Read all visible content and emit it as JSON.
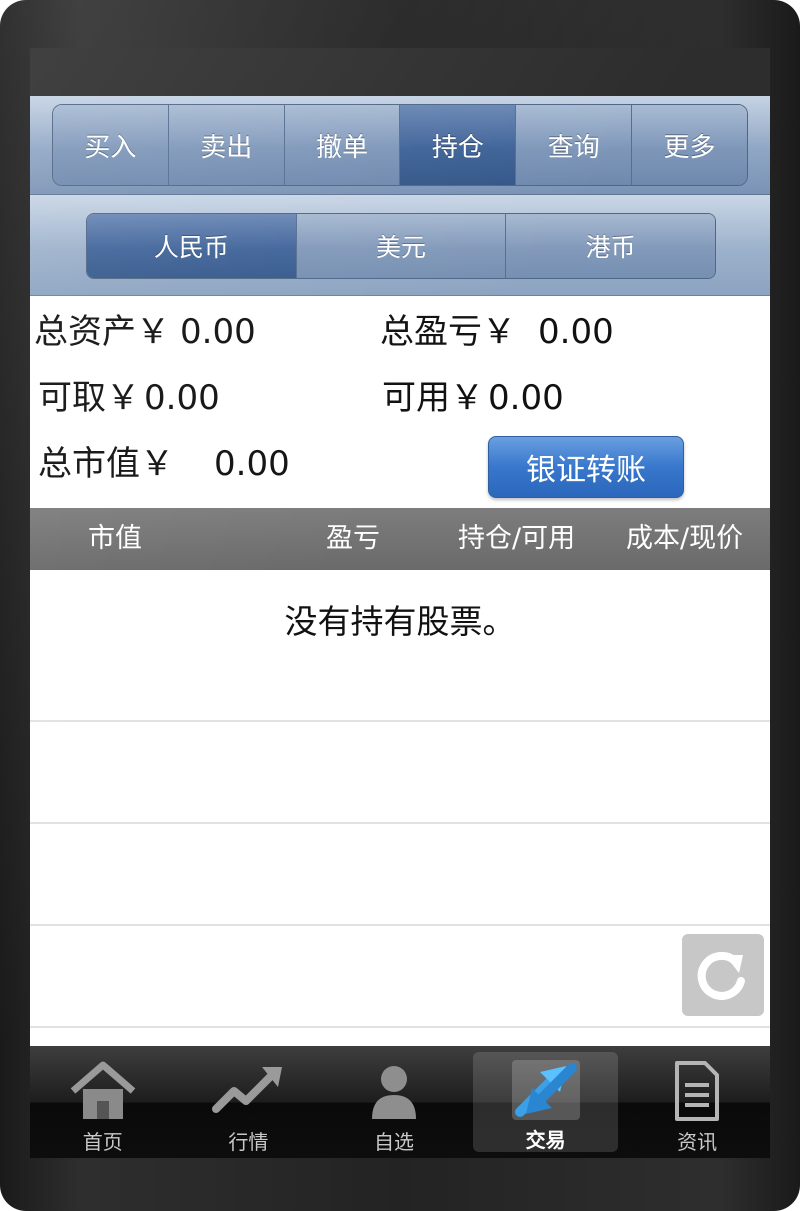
{
  "top_tabs": [
    {
      "label": "买入"
    },
    {
      "label": "卖出"
    },
    {
      "label": "撤单"
    },
    {
      "label": "持仓"
    },
    {
      "label": "查询"
    },
    {
      "label": "更多"
    }
  ],
  "currency_tabs": [
    {
      "label": "人民币"
    },
    {
      "label": "美元"
    },
    {
      "label": "港币"
    }
  ],
  "summary": {
    "total_assets": {
      "label": "总资产￥",
      "value": "0.00"
    },
    "total_pnl": {
      "label": "总盈亏￥",
      "value": "0.00"
    },
    "withdrawable": {
      "label": "可取￥",
      "value": "0.00"
    },
    "available": {
      "label": "可用￥",
      "value": "0.00"
    },
    "market_value": {
      "label": "总市值￥",
      "value": "0.00"
    },
    "transfer_button": "银证转账"
  },
  "table": {
    "columns": [
      "市值",
      "盈亏",
      "持仓/可用",
      "成本/现价"
    ],
    "empty_message": "没有持有股票。"
  },
  "bottom_nav": [
    {
      "label": "首页",
      "icon": "home-icon"
    },
    {
      "label": "行情",
      "icon": "trend-chart-icon"
    },
    {
      "label": "自选",
      "icon": "person-icon"
    },
    {
      "label": "交易",
      "icon": "trade-exchange-icon"
    },
    {
      "label": "资讯",
      "icon": "document-icon"
    }
  ],
  "colors": {
    "accent_blue": "#3877cc",
    "tab_active": "#40649a",
    "header_gray": "#6a6a6a"
  }
}
